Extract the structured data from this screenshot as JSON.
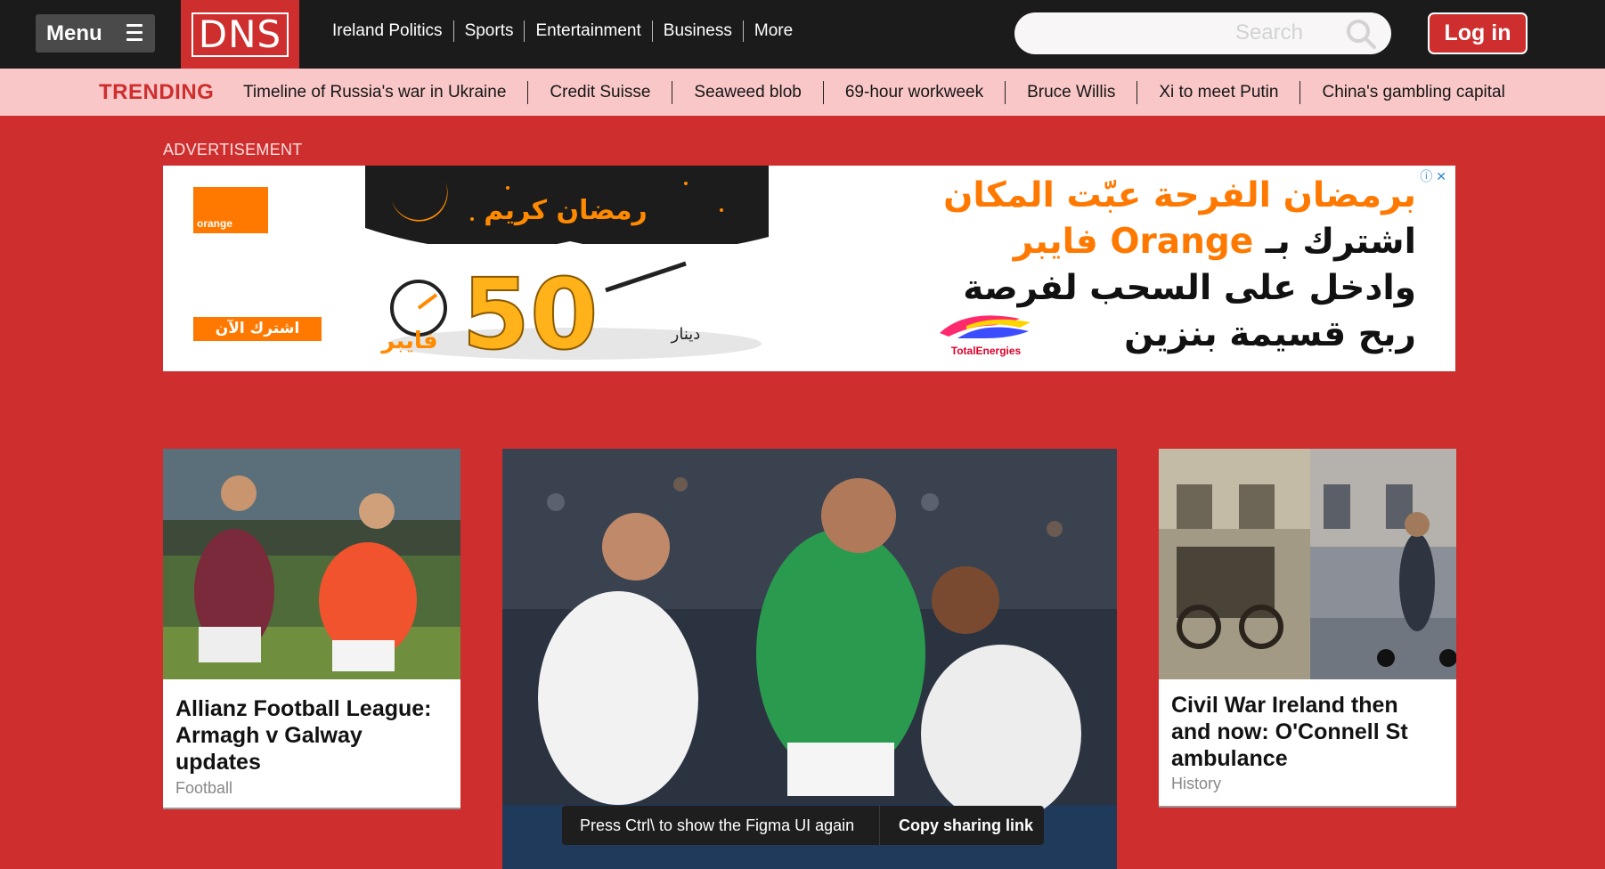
{
  "header": {
    "menu_label": "Menu",
    "logo_text": "DNS",
    "nav": [
      "Ireland Politics",
      "Sports",
      "Entertainment",
      "Business",
      "More"
    ],
    "search_placeholder": "Search",
    "login_label": "Log in"
  },
  "trending": {
    "label": "TRENDING",
    "items": [
      "Timeline of Russia's war in Ukraine",
      "Credit Suisse",
      "Seaweed blob",
      "69-hour workweek",
      "Bruce Willis",
      "Xi to meet Putin",
      "China's gambling capital"
    ]
  },
  "ad": {
    "label": "ADVERTISEMENT",
    "brand": "orange",
    "subscribe": "اشترك الآن",
    "promo_greeting": "رمضان كريم",
    "promo_amount": "50",
    "promo_unit": "دينار",
    "promo_product": "فايبر",
    "lines": [
      "برمضان الفرحة عبّت المكان",
      "اشترك بـ",
      "Orange فايبر",
      "وادخل على السحب لفرصة",
      "ربح قسيمة بنزين"
    ],
    "partner": "TotalEnergies"
  },
  "cards": [
    {
      "title": "Allianz Football League: Armagh v Galway updates",
      "category": "Football"
    },
    {
      "title": "",
      "category": ""
    },
    {
      "title": "Civil War Ireland then and now: O'Connell St ambulance",
      "category": "History"
    }
  ],
  "toast": {
    "message": "Press Ctrl\\ to show the Figma UI again",
    "action": "Copy sharing link"
  },
  "colors": {
    "brand_red": "#cf2e2e",
    "topbar": "#1b1b1b",
    "trending_bg": "#f9c7c7",
    "orange": "#ff7900"
  }
}
